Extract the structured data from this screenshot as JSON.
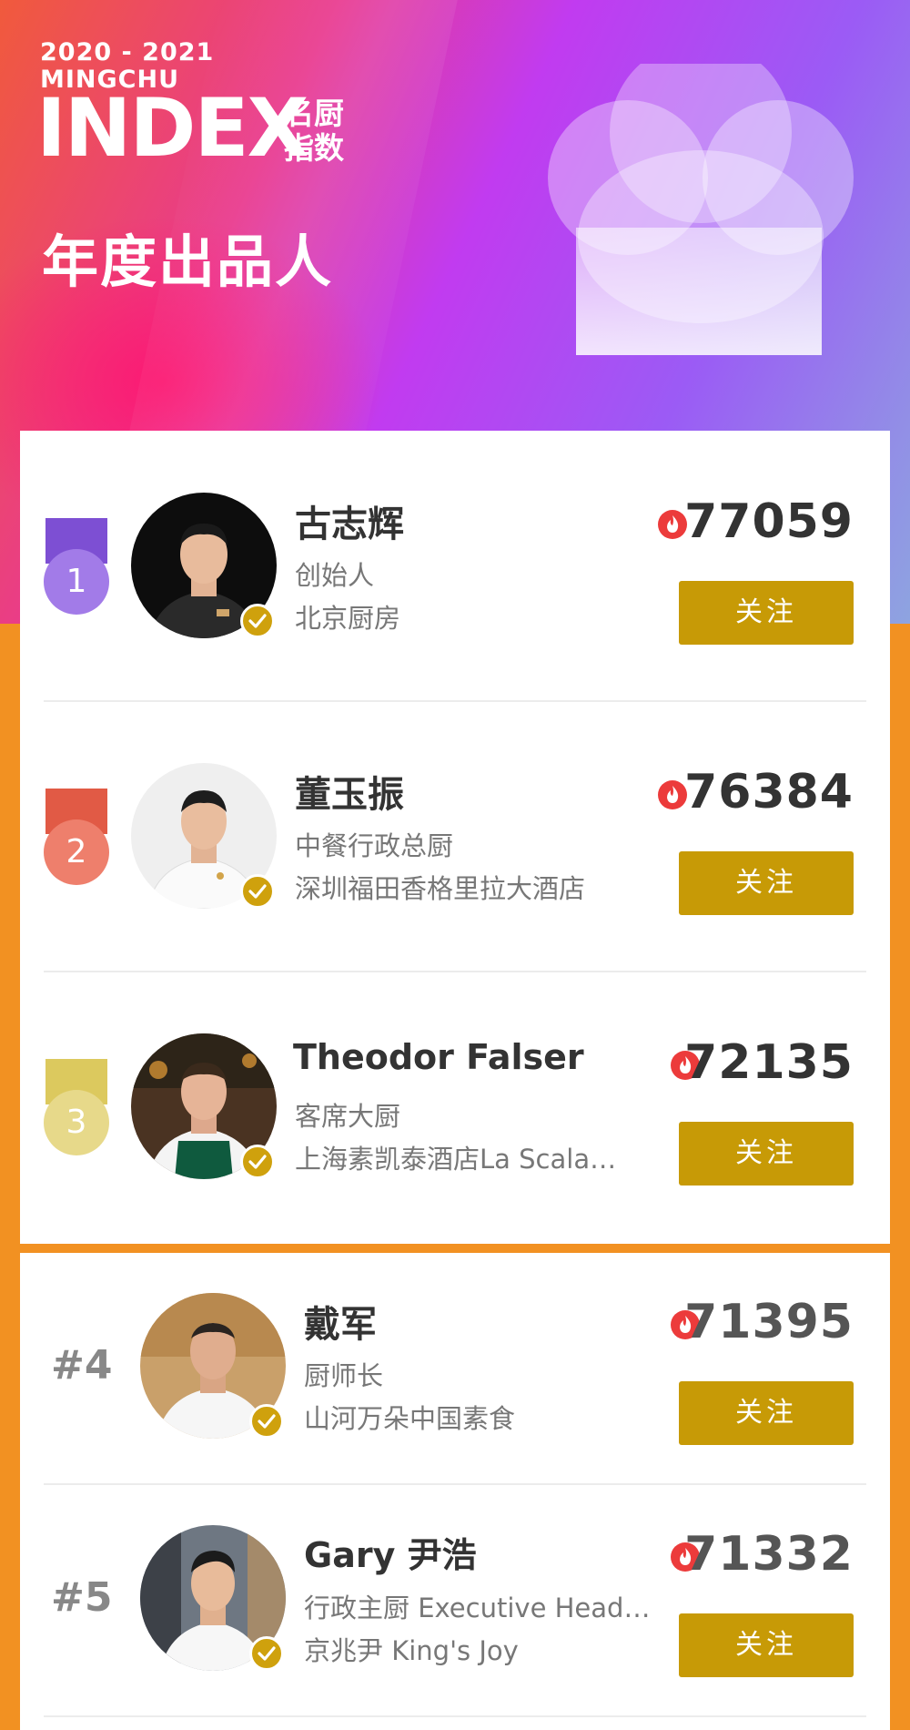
{
  "header": {
    "years": "2020 - 2021",
    "brand": "MINGCHU",
    "index_word": "INDEX",
    "index_cn": "名厨指数",
    "subtitle": "年度出品人"
  },
  "follow_label": "关注",
  "colors": {
    "gold_button": "#c79a06",
    "page_background": "#f29122",
    "medal_1": "#a27be8",
    "medal_2": "#ee7f6c",
    "medal_3": "#e7d98a"
  },
  "top_chefs": [
    {
      "rank": "1",
      "name": "古志辉",
      "title": "创始人",
      "org": "北京厨房",
      "score": "77059"
    },
    {
      "rank": "2",
      "name": "董玉振",
      "title": "中餐行政总厨",
      "org": "深圳福田香格里拉大酒店",
      "score": "76384"
    },
    {
      "rank": "3",
      "name": "Theodor Falser",
      "title": "客席大厨",
      "org": "上海素凯泰酒店La Scala…",
      "score": "72135"
    }
  ],
  "other_chefs": [
    {
      "rank": "#4",
      "name": "戴军",
      "title": "厨师长",
      "org": "山河万朵中国素食",
      "score": "71395"
    },
    {
      "rank": "#5",
      "name": "Gary 尹浩",
      "title": "行政主厨 Executive Head…",
      "org": "京兆尹 King's Joy",
      "score": "71332"
    }
  ],
  "icons": {
    "hat": "chef-hat-icon",
    "flame": "flame-icon",
    "verified": "verified-check-icon",
    "medal": "medal-icon"
  }
}
